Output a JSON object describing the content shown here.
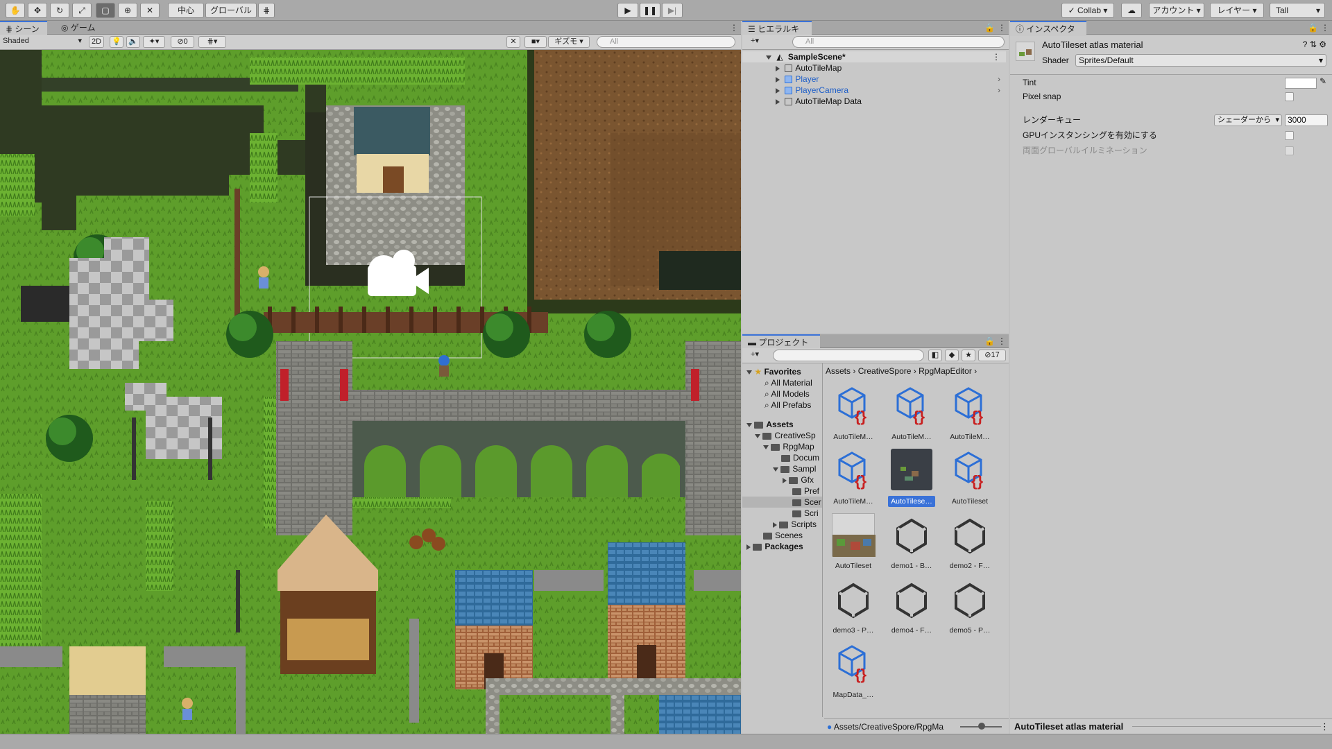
{
  "toolbar": {
    "pivot_label": "中心",
    "space_label": "グローバル",
    "collab_label": "Collab",
    "account_label": "アカウント",
    "layers_label": "レイヤー",
    "layout_label": "Tall"
  },
  "scene_panel": {
    "tabs": [
      "シーン",
      "ゲーム"
    ],
    "draw_mode": "Shaded",
    "mode_2d": "2D",
    "hidden_count": "0",
    "gizmos_label": "ギズモ",
    "search_placeholder": "All"
  },
  "hierarchy": {
    "tab_label": "ヒエラルキー",
    "search_placeholder": "All",
    "scene_name": "SampleScene*",
    "items": [
      {
        "name": "AutoTileMap",
        "prefab": false
      },
      {
        "name": "Player",
        "prefab": true
      },
      {
        "name": "PlayerCamera",
        "prefab": true
      },
      {
        "name": "AutoTileMap Data",
        "prefab": false
      }
    ]
  },
  "project": {
    "tab_label": "プロジェクト",
    "hidden_count": "17",
    "breadcrumb": [
      "Assets",
      "CreativeSpore",
      "RpgMapEditor"
    ],
    "favorites_label": "Favorites",
    "favorites": [
      "All Material",
      "All Models",
      "All Prefabs"
    ],
    "assets_label": "Assets",
    "tree": [
      {
        "label": "CreativeSp",
        "indent": 1
      },
      {
        "label": "RpgMap",
        "indent": 2
      },
      {
        "label": "Docum",
        "indent": 3
      },
      {
        "label": "Sampl",
        "indent": 3
      },
      {
        "label": "Gfx",
        "indent": 4
      },
      {
        "label": "Pref",
        "indent": 4
      },
      {
        "label": "Scer",
        "indent": 4
      },
      {
        "label": "Scri",
        "indent": 4
      },
      {
        "label": "Scripts",
        "indent": 3
      },
      {
        "label": "Scenes",
        "indent": 1
      }
    ],
    "packages_label": "Packages",
    "assets": [
      {
        "label": "AutoTileM…",
        "kind": "script"
      },
      {
        "label": "AutoTileM…",
        "kind": "script"
      },
      {
        "label": "AutoTileM…",
        "kind": "script"
      },
      {
        "label": "AutoTileM…",
        "kind": "script"
      },
      {
        "label": "AutoTilese…",
        "kind": "material",
        "selected": true
      },
      {
        "label": "AutoTileset",
        "kind": "script"
      },
      {
        "label": "AutoTileset",
        "kind": "texture"
      },
      {
        "label": "demo1 - B…",
        "kind": "unity"
      },
      {
        "label": "demo2 - F…",
        "kind": "unity"
      },
      {
        "label": "demo3 - P…",
        "kind": "unity"
      },
      {
        "label": "demo4 - F…",
        "kind": "unity"
      },
      {
        "label": "demo5 - P…",
        "kind": "unity"
      },
      {
        "label": "MapData_…",
        "kind": "script"
      }
    ],
    "footer_path": "Assets/CreativeSpore/RpgMa"
  },
  "inspector": {
    "tab_label": "インスペクター",
    "title": "AutoTileset atlas material",
    "shader_label": "Shader",
    "shader_value": "Sprites/Default",
    "props": {
      "tint": "Tint",
      "pixel_snap": "Pixel snap",
      "render_queue": "レンダーキュー",
      "render_queue_mode": "シェーダーから",
      "render_queue_value": "3000",
      "gpu_instancing": "GPUインスタンシングを有効にする",
      "double_gi": "両面グローバルイルミネーション"
    },
    "footer_title": "AutoTileset atlas material"
  },
  "colors": {
    "accent": "#3a72d8",
    "script_brace": "#c82020",
    "grass": "#5b9a2c"
  }
}
